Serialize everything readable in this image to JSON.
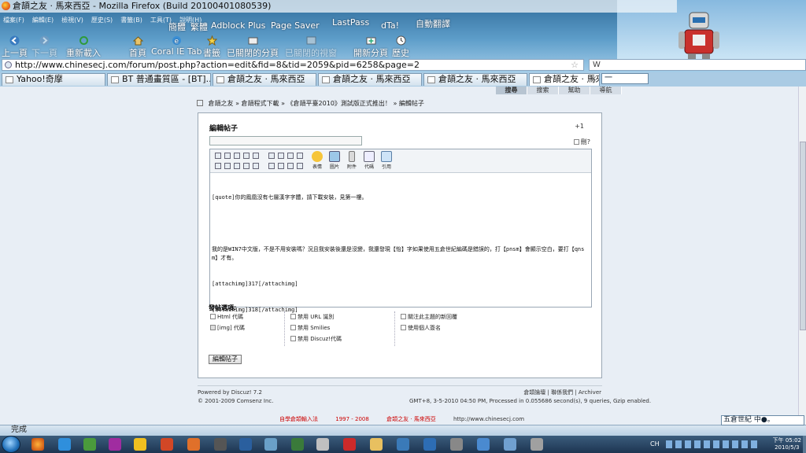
{
  "window": {
    "title": "倉頡之友 ‧ 馬來西亞 - Mozilla Firefox (Build 20100401080539)"
  },
  "menubar": [
    "檔案(F)",
    "編輯(E)",
    "檢視(V)",
    "歷史(S)",
    "書籤(B)",
    "工具(T)",
    "說明(H)"
  ],
  "toolbar": {
    "back": "上一頁",
    "forward": "下一頁",
    "reload": "重新載入",
    "home": "首頁",
    "coral": "Coral IE Tab",
    "bookmarks": "書籤",
    "closed_tabs": "已關閉的分頁",
    "closed_windows": "已關閉的視窗",
    "new_tab": "開新分頁",
    "history": "歷史"
  },
  "addons": {
    "simplified": "簡體",
    "traditional": "繁體",
    "adblock": "Adblock Plus",
    "pagesaver": "Page Saver",
    "lastpass": "LastPass",
    "dtai": "dTa!",
    "translate": "自動翻譯"
  },
  "urlbar": {
    "url": "http://www.chinesecj.com/forum/post.php?action=edit&fid=8&tid=2059&pid=6258&page=2"
  },
  "searchbar": {
    "placeholder": "W"
  },
  "tabs": [
    {
      "label": "Yahoo!奇摩"
    },
    {
      "label": "BT 普通畫質區 - [BT]..."
    },
    {
      "label": "倉頡之友 ‧ 馬來西亞"
    },
    {
      "label": "倉頡之友 ‧ 馬來西亞"
    },
    {
      "label": "倉頡之友 ‧ 馬來西亞"
    },
    {
      "label": "倉頡之友 ‧ 馬來西亞"
    }
  ],
  "ime_popup": {
    "text": "一"
  },
  "site_nav": [
    "搜尋",
    "搜索",
    "幫助",
    "導航"
  ],
  "breadcrumb": {
    "home": "倉頡之友",
    "sep": "»",
    "forum": "倉頡程式下載",
    "thread": "《倉頡平臺2010》測試版正式推出！",
    "current": "編輯帖子"
  },
  "form": {
    "title": "編輯帖子",
    "plus_one": "+1",
    "anonymous_label": "刪?",
    "editor_buttons": {
      "emoticons": "表情",
      "image": "圖片",
      "attachment": "附件",
      "code": "代碼",
      "quote": "引用"
    },
    "content_lines": [
      "[quote]你的鳳凰沒有七層漢字字體，請下載安裝，見第一樓。",
      "",
      "我的是WIN7中文版，不是不用安裝嗎？況且我安裝後還是沒變，我還發現【怡】字如果使用五倉世紀編碼是錯誤的，打【pnsm】會顯示空白，要打【qnsm】才有。",
      "[attachimg]317[/attachimg]",
      "[attachimg]318[/attachimg]"
    ],
    "options_heading": "發帖選項:",
    "options": {
      "html": "Html 代碼",
      "imgcode": "[img] 代碼",
      "disable_url": "禁用 URL 識別",
      "disable_smilies": "禁用 Smilies",
      "disable_discuz": "禁用 Discuz!代碼",
      "notify": "關注此主題的新回覆",
      "signature": "使用個人簽名"
    },
    "submit": "編輯帖子"
  },
  "footer": {
    "powered": "Powered by Discuz! 7.2",
    "copyright": "© 2001-2009 Comsenz Inc.",
    "links": "倉頡論壇 | 聯係我們 | Archiver",
    "server_info": "GMT+8, 3-5-2010 04:50 PM, Processed in 0.055686 second(s), 9 queries, Gzip enabled.",
    "bottom_left": "自學倉頡輸入法",
    "bottom_years": "1997 - 2008",
    "bottom_site": "倉頡之友 ‧ 馬來西亞",
    "bottom_url": "http://www.chinesecj.com"
  },
  "statusbar": {
    "text": "完成"
  },
  "ime_bar": {
    "text": "五倉世紀 中●。"
  },
  "taskbar": {
    "lang": "CH",
    "time": "下午 05:02",
    "date": "2010/5/3"
  },
  "colors": {
    "link_red": "#cc0000",
    "chrome_blue": "#2f6b9a"
  }
}
